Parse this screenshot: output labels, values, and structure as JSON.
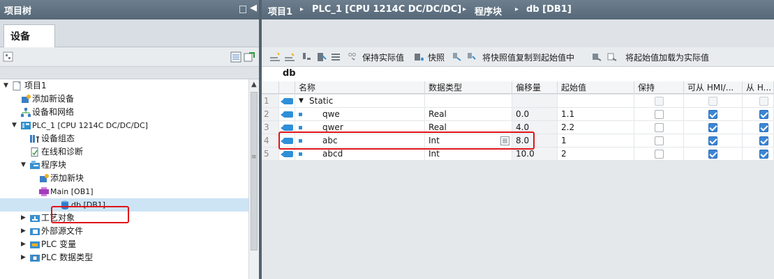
{
  "left_panel": {
    "title": "项目树",
    "tab": "设备",
    "tree": [
      {
        "label": "项目1",
        "indent": 0,
        "arrow": "▼",
        "icon": "project-icon"
      },
      {
        "label": "添加新设备",
        "indent": 1,
        "arrow": "",
        "icon": "add-device-icon"
      },
      {
        "label": "设备和网络",
        "indent": 1,
        "arrow": "",
        "icon": "network-icon"
      },
      {
        "label": "PLC_1 [CPU 1214C DC/DC/DC]",
        "indent": 1,
        "arrow": "▼",
        "icon": "plc-icon"
      },
      {
        "label": "设备组态",
        "indent": 2,
        "arrow": "",
        "icon": "device-config-icon"
      },
      {
        "label": "在线和诊断",
        "indent": 2,
        "arrow": "",
        "icon": "diagnostics-icon"
      },
      {
        "label": "程序块",
        "indent": 2,
        "arrow": "▼",
        "icon": "program-blocks-icon"
      },
      {
        "label": "添加新块",
        "indent": 3,
        "arrow": "",
        "icon": "add-block-icon"
      },
      {
        "label": "Main [OB1]",
        "indent": 3,
        "arrow": "",
        "icon": "ob-icon"
      },
      {
        "label": "db [DB1]",
        "indent": 3,
        "arrow": "",
        "icon": "db-icon",
        "selected": true
      },
      {
        "label": "工艺对象",
        "indent": 2,
        "arrow": "▶",
        "icon": "technology-object-icon"
      },
      {
        "label": "外部源文件",
        "indent": 2,
        "arrow": "▶",
        "icon": "external-source-icon"
      },
      {
        "label": "PLC 变量",
        "indent": 2,
        "arrow": "▶",
        "icon": "plc-tags-icon"
      },
      {
        "label": "PLC 数据类型",
        "indent": 2,
        "arrow": "▶",
        "icon": "plc-datatype-icon"
      }
    ]
  },
  "breadcrumb": {
    "items": [
      "项目1",
      "PLC_1 [CPU 1214C DC/DC/DC]",
      "程序块",
      "db [DB1]"
    ],
    "separator": "▸"
  },
  "toolbar": {
    "keep_actual": "保持实际值",
    "snapshot": "快照",
    "copy_snapshot": "将快照值复制到起始值中",
    "load_start": "将起始值加载为实际值"
  },
  "db": {
    "name": "db",
    "columns": [
      "名称",
      "数据类型",
      "偏移量",
      "起始值",
      "保持",
      "可从 HMI/...",
      "从 H..."
    ],
    "rows": [
      {
        "num": "1",
        "name": "Static",
        "type": "",
        "offset": "",
        "start": "",
        "retain": false,
        "hmi": false,
        "from_h": false,
        "is_group": true
      },
      {
        "num": "2",
        "name": "qwe",
        "type": "Real",
        "offset": "0.0",
        "start": "1.1",
        "retain": false,
        "hmi": true,
        "from_h": true
      },
      {
        "num": "3",
        "name": "qwer",
        "type": "Real",
        "offset": "4.0",
        "start": "2.2",
        "retain": false,
        "hmi": true,
        "from_h": true
      },
      {
        "num": "4",
        "name": "abc",
        "type": "Int",
        "offset": "8.0",
        "start": "1",
        "retain": false,
        "hmi": true,
        "from_h": true
      },
      {
        "num": "5",
        "name": "abcd",
        "type": "Int",
        "offset": "10.0",
        "start": "2",
        "retain": false,
        "hmi": true,
        "from_h": true
      }
    ]
  },
  "colors": {
    "title_bar": "#5d6f7f",
    "highlight": "#e0141a",
    "selection": "#cde4f5",
    "checkbox": "#3b86d6"
  }
}
